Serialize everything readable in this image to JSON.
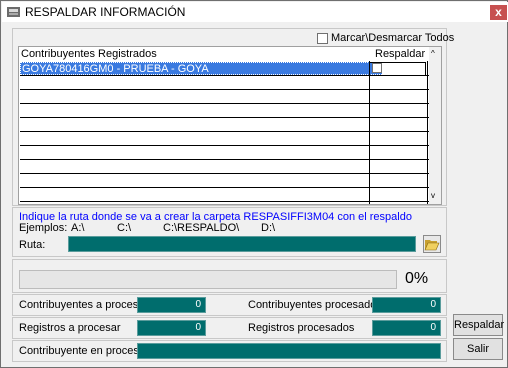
{
  "window": {
    "title": "RESPALDAR INFORMACIÓN",
    "close_label": "x"
  },
  "select_all": {
    "label": "Marcar\\Desmarcar Todos",
    "checked": false
  },
  "table": {
    "headers": [
      "Contribuyentes Registrados",
      "Respaldar"
    ],
    "rows": [
      {
        "contribuyente": "GOYA780416GM0 - PRUEBA - GOYA",
        "respaldar": false
      }
    ],
    "scroll_up": "^",
    "scroll_down": "v"
  },
  "path": {
    "instruction": "Indique la ruta donde se va a crear la carpeta RESPASIFFI3M04 con el respaldo",
    "examples_label": "Ejemplos:",
    "examples": [
      "A:\\",
      "C:\\",
      "C:\\RESPALDO\\",
      "D:\\"
    ],
    "ruta_label": "Ruta:",
    "ruta_value": "",
    "folder_icon": "open-folder-icon"
  },
  "progress": {
    "value": 0,
    "percent_label": "0%"
  },
  "stats": {
    "contribuyentes_a_procesar": {
      "label": "Contribuyentes a procesar",
      "value": "0"
    },
    "contribuyentes_procesados": {
      "label": "Contribuyentes procesados",
      "value": "0"
    },
    "registros_a_procesar": {
      "label": "Registros a procesar",
      "value": "0"
    },
    "registros_procesados": {
      "label": "Registros procesados",
      "value": "0"
    },
    "contribuyente_en_proceso": {
      "label": "Contribuyente en proceso",
      "value": ""
    }
  },
  "buttons": {
    "respaldar": "Respaldar",
    "salir": "Salir"
  },
  "colors": {
    "selection": "#3a7ae0",
    "field": "#006d6d",
    "instruction_text": "#0000ff"
  }
}
